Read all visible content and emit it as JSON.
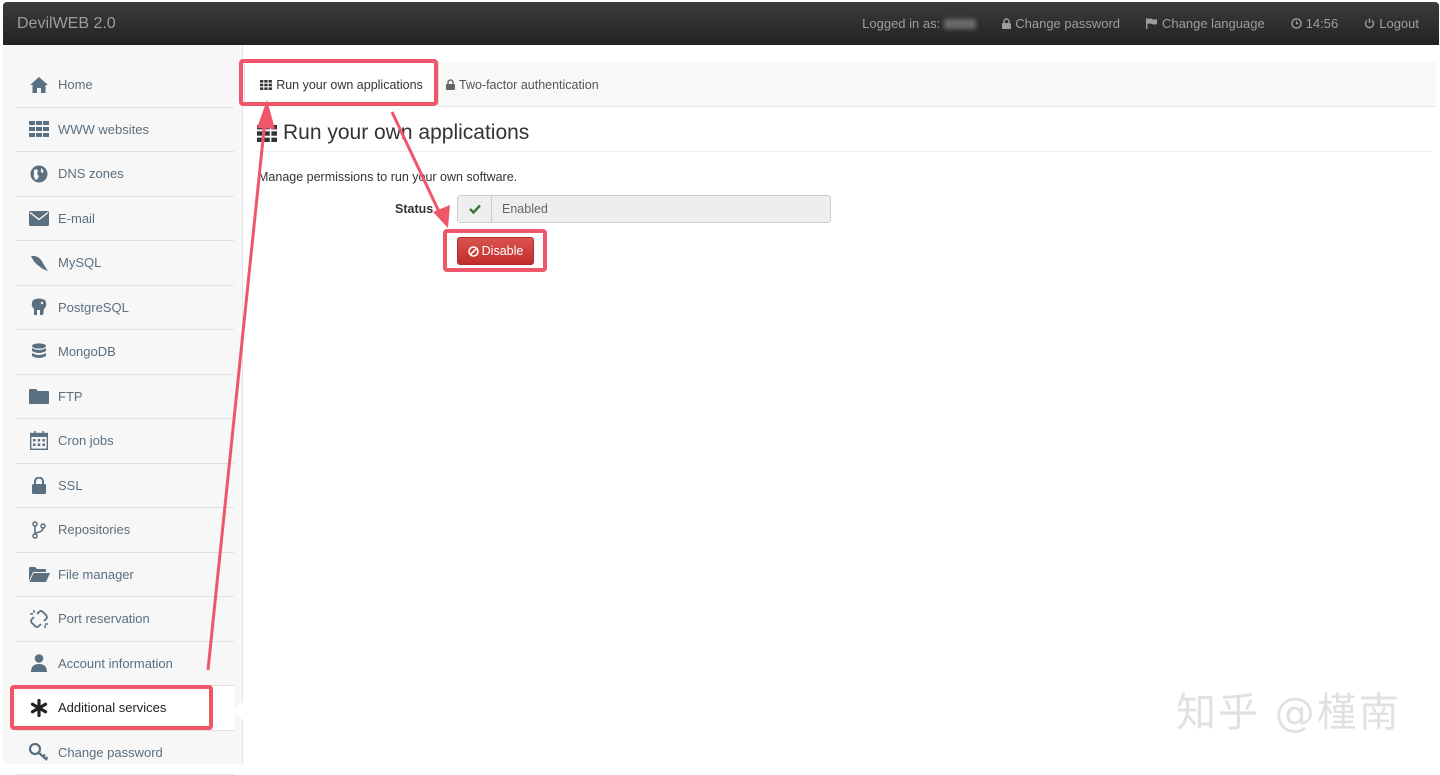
{
  "app": {
    "title": "DevilWEB 2.0"
  },
  "navbar": {
    "logged_in_label": "Logged in as:",
    "change_password": "Change password",
    "change_language": "Change language",
    "time": "14:56",
    "logout": "Logout"
  },
  "sidebar": {
    "items": [
      {
        "label": "Home",
        "icon": "home-icon"
      },
      {
        "label": "WWW websites",
        "icon": "grid-icon"
      },
      {
        "label": "DNS zones",
        "icon": "globe-icon"
      },
      {
        "label": "E-mail",
        "icon": "envelope-icon"
      },
      {
        "label": "MySQL",
        "icon": "dolphin-icon"
      },
      {
        "label": "PostgreSQL",
        "icon": "elephant-icon"
      },
      {
        "label": "MongoDB",
        "icon": "database-icon"
      },
      {
        "label": "FTP",
        "icon": "folder-icon"
      },
      {
        "label": "Cron jobs",
        "icon": "calendar-icon"
      },
      {
        "label": "SSL",
        "icon": "lock-icon"
      },
      {
        "label": "Repositories",
        "icon": "branch-icon"
      },
      {
        "label": "File manager",
        "icon": "folder-open-icon"
      },
      {
        "label": "Port reservation",
        "icon": "unlink-icon"
      },
      {
        "label": "Account information",
        "icon": "user-icon"
      },
      {
        "label": "Additional services",
        "icon": "asterisk-icon"
      },
      {
        "label": "Change password",
        "icon": "key-icon"
      }
    ]
  },
  "tabs": [
    {
      "label": "Run your own applications",
      "icon": "th-icon",
      "active": true
    },
    {
      "label": "Two-factor authentication",
      "icon": "lock-icon",
      "active": false
    }
  ],
  "main": {
    "title": "Run your own applications",
    "description": "Manage permissions to run your own software.",
    "status_label": "Status",
    "status_value": "Enabled",
    "disable_button": "Disable"
  },
  "colors": {
    "highlight": "#f0566a",
    "danger": "#d9534f",
    "success_check": "#3c763d"
  },
  "watermark": "知乎 @槿南"
}
